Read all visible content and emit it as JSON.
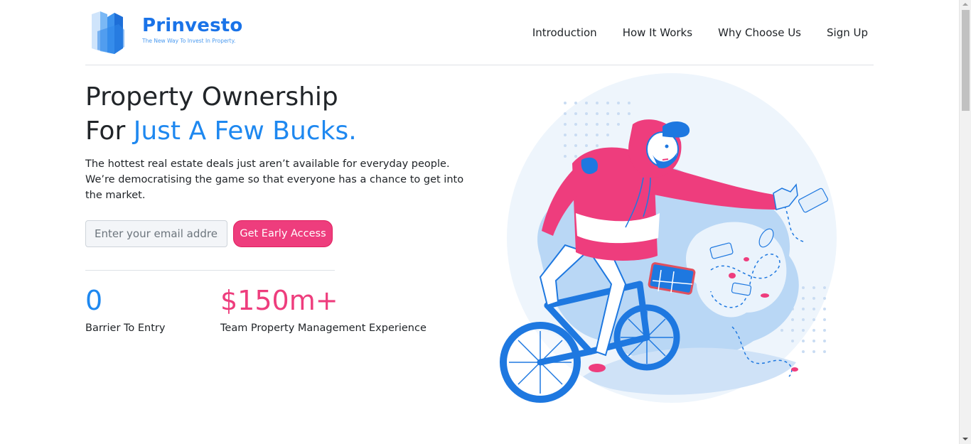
{
  "header": {
    "brand_name": "Prinvesto",
    "brand_tagline": "The New Way To Invest In Property.",
    "nav": [
      {
        "label": "Introduction"
      },
      {
        "label": "How It Works"
      },
      {
        "label": "Why Choose Us"
      },
      {
        "label": "Sign Up"
      }
    ]
  },
  "hero": {
    "title_line1": "Property Ownership",
    "title_line2_prefix": "For ",
    "title_line2_accent": "Just A Few Bucks.",
    "description": "The hottest real estate deals just aren’t available for everyday people. We’re democratising the game so that everyone has a chance to get into the market.",
    "email_placeholder": "Enter your email address",
    "email_value": "",
    "cta_label": "Get Early Access"
  },
  "stats": [
    {
      "value": "0",
      "label": "Barrier To Entry"
    },
    {
      "value": "$150m+",
      "label": "Team Property Management Experience"
    }
  ],
  "colors": {
    "accent_blue": "#1e88f0",
    "accent_pink": "#ee3d7d",
    "text": "#212529"
  },
  "icons": {
    "logo": "building-blocks-logo-icon",
    "illustration": "cyclist-illustration"
  }
}
